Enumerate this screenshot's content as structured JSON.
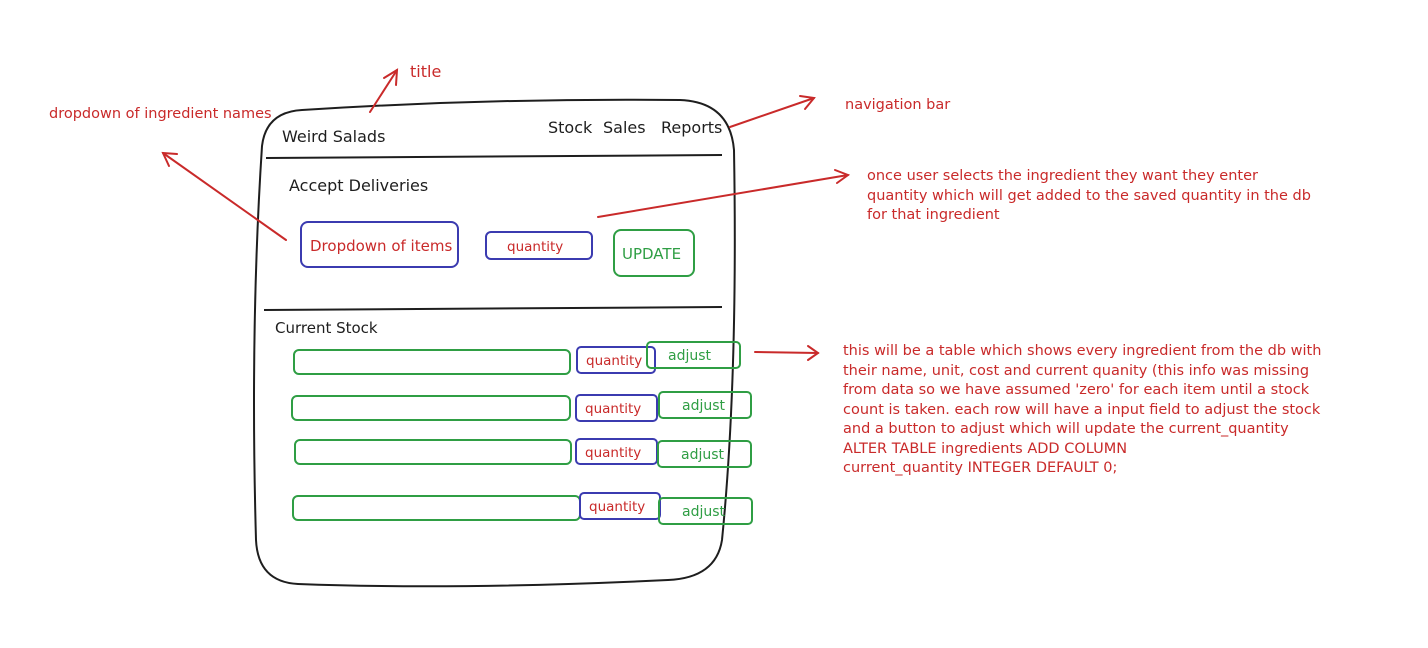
{
  "annotations": {
    "title": "title",
    "dropdown_names": "dropdown of ingredient names",
    "navigation_bar": "navigation bar",
    "quantity_note": [
      "once user selects the ingredient they want they enter",
      "quantity which will get added to the saved quantity in the db",
      "for that ingredient"
    ],
    "table_note": [
      "this will be a table which shows every ingredient from the db with",
      "their name, unit, cost and current quanity (this info was missing",
      "from data so we have assumed 'zero' for each item until a stock",
      "count is taken. each row will have a input field to adjust the stock",
      "and a button to adjust which will update the current_quantity",
      "ALTER TABLE ingredients ADD COLUMN",
      "current_quantity INTEGER DEFAULT 0;"
    ]
  },
  "app": {
    "title": "Weird Salads",
    "nav": [
      "Stock",
      "Sales",
      "Reports"
    ]
  },
  "deliveries": {
    "heading": "Accept Deliveries",
    "dropdown_label": "Dropdown of items",
    "quantity_label": "quantity",
    "update_label": "UPDATE"
  },
  "stock": {
    "heading": "Current Stock",
    "rows": [
      {
        "quantity_label": "quantity",
        "adjust_label": "adjust"
      },
      {
        "quantity_label": "quantity",
        "adjust_label": "adjust"
      },
      {
        "quantity_label": "quantity",
        "adjust_label": "adjust"
      },
      {
        "quantity_label": "quantity",
        "adjust_label": "adjust"
      }
    ]
  },
  "colors": {
    "annotation": "#c92a2a",
    "ink": "#1e1e1e",
    "blue": "#3b3bb0",
    "green": "#2f9e44"
  }
}
